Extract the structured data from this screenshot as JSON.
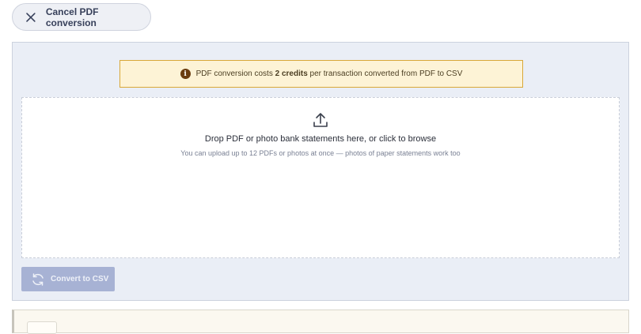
{
  "cancel": {
    "label": "Cancel PDF conversion",
    "icon": "close-icon"
  },
  "notice": {
    "prefix": "PDF conversion costs ",
    "credits": "2 credits",
    "suffix": " per transaction converted from PDF to CSV",
    "icon": "info-icon",
    "icon_glyph": "i",
    "bg_color": "#fdf3d6",
    "border_color": "#d9a838"
  },
  "dropzone": {
    "icon": "upload-icon",
    "title": "Drop PDF or photo bank statements here, or click to browse",
    "subtitle": "You can upload up to 12 PDFs or photos at once — photos of paper statements work too"
  },
  "convert": {
    "label": "Convert to CSV",
    "icon": "refresh-icon",
    "disabled": true,
    "color": "#a7b2d4"
  }
}
